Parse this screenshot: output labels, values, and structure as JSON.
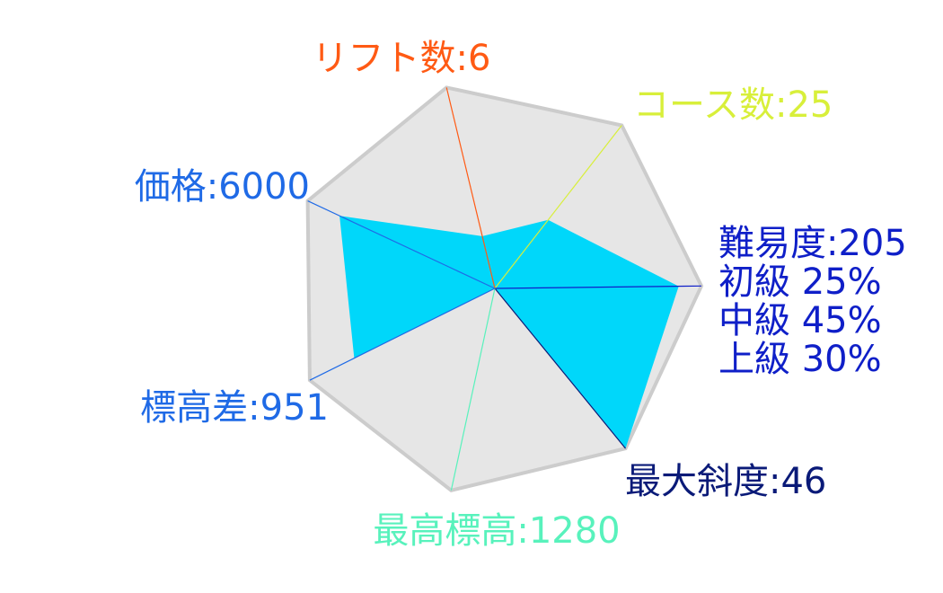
{
  "chart_data": {
    "type": "radar",
    "title": "",
    "grid": true,
    "legend": "none",
    "axes": [
      {
        "name": "リフト数",
        "value": "6",
        "color": "#ff5a14",
        "score": 0.26
      },
      {
        "name": "コース数",
        "value": "25",
        "color": "#d8ef3a",
        "score": 0.42
      },
      {
        "name": "難易度",
        "value": "205",
        "color": "#0f1fc8",
        "score": 0.89,
        "extra_lines": [
          "初級  25%",
          "中級  45%",
          "上級  30%"
        ]
      },
      {
        "name": "最大斜度",
        "value": "46",
        "color": "#0a1a78",
        "score": 1.0
      },
      {
        "name": "最高標高",
        "value": "1280",
        "color": "#58f2bc",
        "score": 0.0
      },
      {
        "name": "標高差",
        "value": "951",
        "color": "#1f6ae6",
        "score": 0.76
      },
      {
        "name": "価格",
        "value": "6000",
        "color": "#1f6ae6",
        "score": 0.83
      }
    ],
    "range": [
      0,
      1
    ],
    "fill_color": "#00d7fa",
    "background_color": "#e6e6e6",
    "outline_color": "#cccccc"
  }
}
